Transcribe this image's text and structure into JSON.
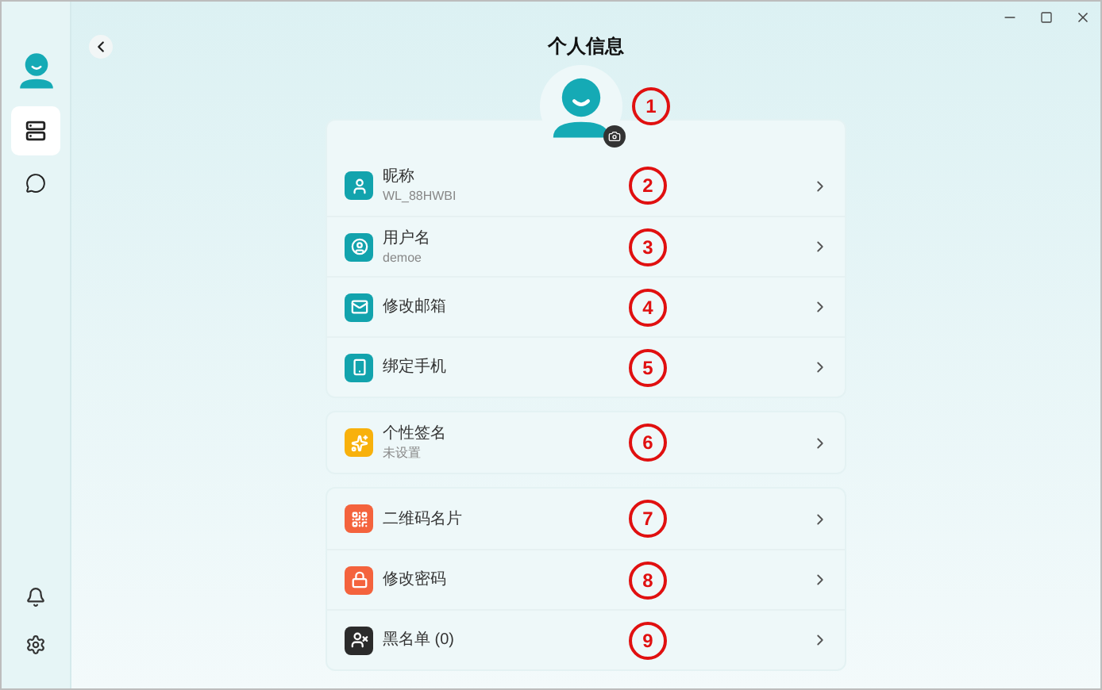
{
  "window": {
    "title": "个人信息"
  },
  "sidebar": {
    "items": [
      {
        "kind": "storage",
        "selected": true
      },
      {
        "kind": "chat",
        "selected": false
      }
    ],
    "bottom_items": [
      {
        "kind": "bell"
      },
      {
        "kind": "settings"
      }
    ]
  },
  "avatar": {
    "marker": "1"
  },
  "groups": [
    [
      {
        "kind": "user",
        "color": "#12a3ad",
        "title": "昵称",
        "subtitle": "WL_88HWBI",
        "marker": "2"
      },
      {
        "kind": "user-circle",
        "color": "#12a3ad",
        "title": "用户名",
        "subtitle": "demoe",
        "marker": "3"
      },
      {
        "kind": "mail",
        "color": "#12a3ad",
        "title": "修改邮箱",
        "marker": "4"
      },
      {
        "kind": "phone",
        "color": "#12a3ad",
        "title": "绑定手机",
        "marker": "5"
      }
    ],
    [
      {
        "kind": "sparkles",
        "color": "#f8b10c",
        "title": "个性签名",
        "subtitle": "未设置",
        "marker": "6"
      }
    ],
    [
      {
        "kind": "qr",
        "color": "#f4633d",
        "title": "二维码名片",
        "marker": "7"
      },
      {
        "kind": "lock",
        "color": "#f4633d",
        "title": "修改密码",
        "marker": "8"
      },
      {
        "kind": "user-x",
        "color": "#2b2b2b",
        "title": "黑名单 (0)",
        "marker": "9"
      }
    ]
  ]
}
